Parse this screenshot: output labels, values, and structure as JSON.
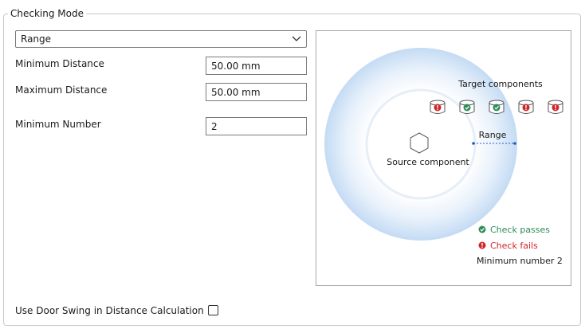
{
  "group": {
    "title": "Checking Mode"
  },
  "mode_select": {
    "value": "Range",
    "icon": "chevron-down-icon"
  },
  "fields": {
    "min_distance": {
      "label": "Minimum Distance",
      "value": "50.00 mm"
    },
    "max_distance": {
      "label": "Maximum Distance",
      "value": "50.00 mm"
    },
    "min_number": {
      "label": "Minimum Number",
      "value": "2"
    }
  },
  "diagram": {
    "target_label": "Target components",
    "range_label": "Range",
    "source_label": "Source component",
    "legend": {
      "pass_label": "Check passes",
      "fail_label": "Check fails",
      "min_number_text": "Minimum number 2"
    },
    "targets": [
      "fail",
      "pass",
      "pass",
      "fail",
      "fail"
    ],
    "colors": {
      "pass": "#2e8b57",
      "fail": "#d0262c",
      "ring": "#cfe2f7",
      "range_line": "#1e5fbf"
    }
  },
  "door_swing": {
    "label": "Use Door Swing in Distance Calculation",
    "checked": false
  }
}
